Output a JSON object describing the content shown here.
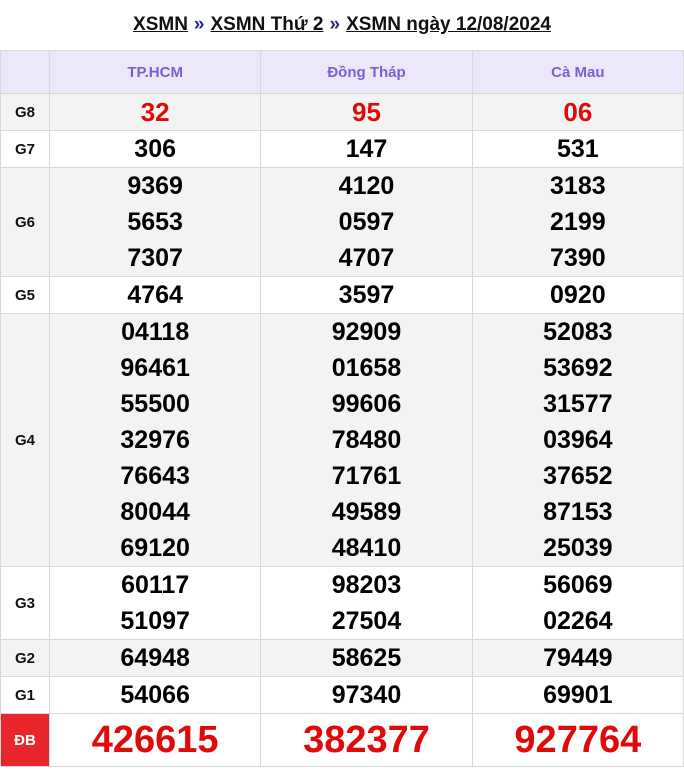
{
  "breadcrumb": {
    "item1": "XSMN",
    "item2": "XSMN Thứ 2",
    "item3": "XSMN ngày 12/08/2024",
    "sep": "»"
  },
  "provinces": [
    "TP.HCM",
    "Đồng Tháp",
    "Cà Mau"
  ],
  "prizes": [
    {
      "label": "G8",
      "values": [
        [
          "32"
        ],
        [
          "95"
        ],
        [
          "06"
        ]
      ]
    },
    {
      "label": "G7",
      "values": [
        [
          "306"
        ],
        [
          "147"
        ],
        [
          "531"
        ]
      ]
    },
    {
      "label": "G6",
      "values": [
        [
          "9369",
          "5653",
          "7307"
        ],
        [
          "4120",
          "0597",
          "4707"
        ],
        [
          "3183",
          "2199",
          "7390"
        ]
      ]
    },
    {
      "label": "G5",
      "values": [
        [
          "4764"
        ],
        [
          "3597"
        ],
        [
          "0920"
        ]
      ]
    },
    {
      "label": "G4",
      "values": [
        [
          "04118",
          "96461",
          "55500",
          "32976",
          "76643",
          "80044",
          "69120"
        ],
        [
          "92909",
          "01658",
          "99606",
          "78480",
          "71761",
          "49589",
          "48410"
        ],
        [
          "52083",
          "53692",
          "31577",
          "03964",
          "37652",
          "87153",
          "25039"
        ]
      ]
    },
    {
      "label": "G3",
      "values": [
        [
          "60117",
          "51097"
        ],
        [
          "98203",
          "27504"
        ],
        [
          "56069",
          "02264"
        ]
      ]
    },
    {
      "label": "G2",
      "values": [
        [
          "64948"
        ],
        [
          "58625"
        ],
        [
          "79449"
        ]
      ]
    },
    {
      "label": "G1",
      "values": [
        [
          "54066"
        ],
        [
          "97340"
        ],
        [
          "69901"
        ]
      ]
    },
    {
      "label": "ĐB",
      "values": [
        [
          "426615"
        ],
        [
          "382377"
        ],
        [
          "927764"
        ]
      ]
    }
  ],
  "colors": {
    "accent_red": "#e10a0a",
    "header_purple": "#7b5fd1",
    "header_bg": "#ece7fb",
    "db_bg": "#e8262c"
  }
}
